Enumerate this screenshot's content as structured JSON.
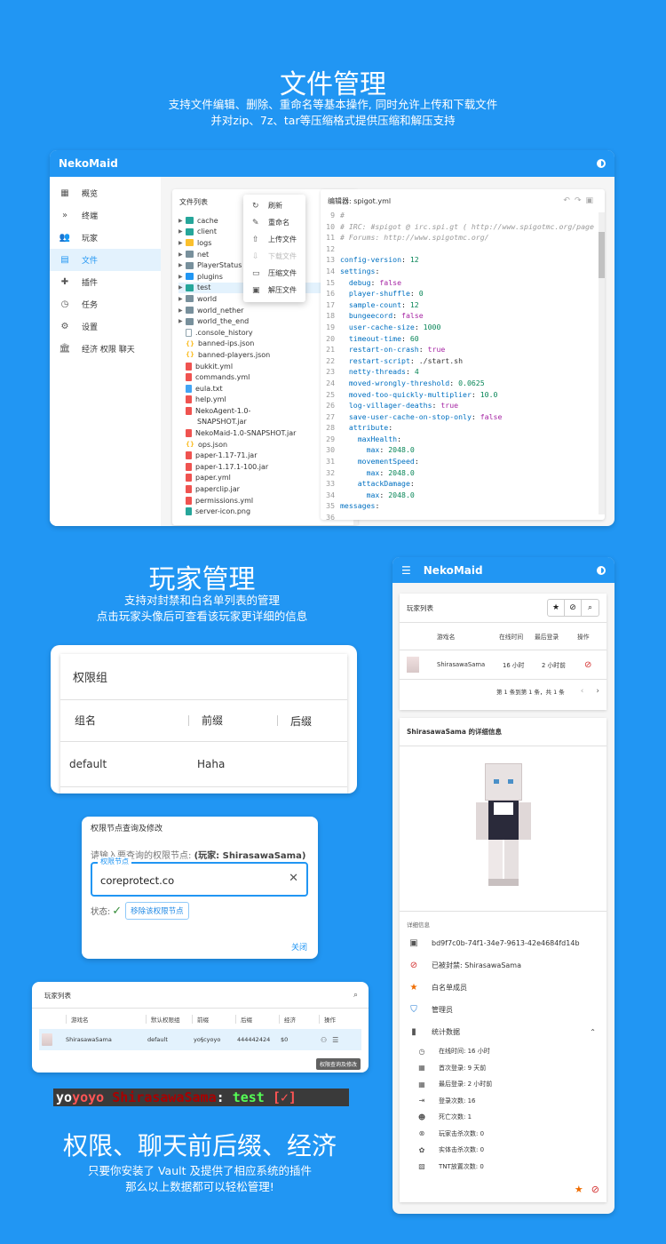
{
  "section1": {
    "title": "文件管理",
    "sub1": "支持文件编辑、删除、重命名等基本操作, 同时允许上传和下载文件",
    "sub2": "并对zip、7z、tar等压缩格式提供压缩和解压支持"
  },
  "app": {
    "brand": "NekoMaid",
    "nav": [
      {
        "label": "概览",
        "icon": "dashboard-icon"
      },
      {
        "label": "终端",
        "icon": "terminal-icon"
      },
      {
        "label": "玩家",
        "icon": "people-icon"
      },
      {
        "label": "文件",
        "icon": "file-icon"
      },
      {
        "label": "插件",
        "icon": "plugin-icon"
      },
      {
        "label": "任务",
        "icon": "clock-icon"
      },
      {
        "label": "设置",
        "icon": "gear-icon"
      },
      {
        "label": "经济 权限 聊天",
        "icon": "bank-icon"
      }
    ]
  },
  "files": {
    "header": "文件列表",
    "items": [
      {
        "name": "cache",
        "type": "folder-teal",
        "expand": true
      },
      {
        "name": "client",
        "type": "folder-teal",
        "expand": true
      },
      {
        "name": "logs",
        "type": "folder-yellow",
        "expand": true
      },
      {
        "name": "net",
        "type": "folder",
        "expand": true
      },
      {
        "name": "PlayerStatus",
        "type": "folder",
        "expand": true
      },
      {
        "name": "plugins",
        "type": "folder-blue",
        "expand": true
      },
      {
        "name": "test",
        "type": "folder-teal",
        "expand": true,
        "selected": true
      },
      {
        "name": "world",
        "type": "folder",
        "expand": true
      },
      {
        "name": "world_nether",
        "type": "folder",
        "expand": true
      },
      {
        "name": "world_the_end",
        "type": "folder",
        "expand": true
      },
      {
        "name": ".console_history",
        "type": "doc"
      },
      {
        "name": "banned-ips.json",
        "type": "json"
      },
      {
        "name": "banned-players.json",
        "type": "json"
      },
      {
        "name": "bukkit.yml",
        "type": "red"
      },
      {
        "name": "commands.yml",
        "type": "red"
      },
      {
        "name": "eula.txt",
        "type": "blue"
      },
      {
        "name": "help.yml",
        "type": "red"
      },
      {
        "name": "NekoAgent-1.0-",
        "type": "red"
      },
      {
        "name": "SNAPSHOT.jar",
        "type": "none"
      },
      {
        "name": "NekoMaid-1.0-SNAPSHOT.jar",
        "type": "red"
      },
      {
        "name": "ops.json",
        "type": "json"
      },
      {
        "name": "paper-1.17-71.jar",
        "type": "red"
      },
      {
        "name": "paper-1.17.1-100.jar",
        "type": "red"
      },
      {
        "name": "paper.yml",
        "type": "red"
      },
      {
        "name": "paperclip.jar",
        "type": "red"
      },
      {
        "name": "permissions.yml",
        "type": "red"
      },
      {
        "name": "server-icon.png",
        "type": "img"
      }
    ]
  },
  "context_menu": [
    {
      "label": "刷新",
      "icon": "refresh-icon"
    },
    {
      "label": "重命名",
      "icon": "edit-icon"
    },
    {
      "label": "上传文件",
      "icon": "upload-icon"
    },
    {
      "label": "下载文件",
      "icon": "download-icon",
      "disabled": true
    },
    {
      "label": "压缩文件",
      "icon": "archive-icon"
    },
    {
      "label": "解压文件",
      "icon": "unarchive-icon"
    }
  ],
  "editor": {
    "title": "编辑器: spigot.yml",
    "lines": [
      {
        "n": "9",
        "t": "#",
        "c": "c"
      },
      {
        "n": "10",
        "t": "# IRC: #spigot @ irc.spi.gt ( http://www.spigotmc.org/page",
        "c": "c"
      },
      {
        "n": "11",
        "t": "# Forums: http://www.spigotmc.org/",
        "c": "c"
      },
      {
        "n": "12",
        "t": "",
        "c": "s"
      },
      {
        "n": "13",
        "k": "config-version",
        "v": "12",
        "vc": "n"
      },
      {
        "n": "14",
        "k": "settings",
        "v": "",
        "vc": "s"
      },
      {
        "n": "15",
        "k": "  debug",
        "v": "false",
        "vc": "b"
      },
      {
        "n": "16",
        "k": "  player-shuffle",
        "v": "0",
        "vc": "n"
      },
      {
        "n": "17",
        "k": "  sample-count",
        "v": "12",
        "vc": "n"
      },
      {
        "n": "18",
        "k": "  bungeecord",
        "v": "false",
        "vc": "b"
      },
      {
        "n": "19",
        "k": "  user-cache-size",
        "v": "1000",
        "vc": "n"
      },
      {
        "n": "20",
        "k": "  timeout-time",
        "v": "60",
        "vc": "n"
      },
      {
        "n": "21",
        "k": "  restart-on-crash",
        "v": "true",
        "vc": "b"
      },
      {
        "n": "22",
        "k": "  restart-script",
        "v": "./start.sh",
        "vc": "s"
      },
      {
        "n": "23",
        "k": "  netty-threads",
        "v": "4",
        "vc": "n"
      },
      {
        "n": "24",
        "k": "  moved-wrongly-threshold",
        "v": "0.0625",
        "vc": "n"
      },
      {
        "n": "25",
        "k": "  moved-too-quickly-multiplier",
        "v": "10.0",
        "vc": "n"
      },
      {
        "n": "26",
        "k": "  log-villager-deaths",
        "v": "true",
        "vc": "b"
      },
      {
        "n": "27",
        "k": "  save-user-cache-on-stop-only",
        "v": "false",
        "vc": "b"
      },
      {
        "n": "28",
        "k": "  attribute",
        "v": "",
        "vc": "s"
      },
      {
        "n": "29",
        "k": "    maxHealth",
        "v": "",
        "vc": "s"
      },
      {
        "n": "30",
        "k": "      max",
        "v": "2048.0",
        "vc": "n"
      },
      {
        "n": "31",
        "k": "    movementSpeed",
        "v": "",
        "vc": "s"
      },
      {
        "n": "32",
        "k": "      max",
        "v": "2048.0",
        "vc": "n"
      },
      {
        "n": "33",
        "k": "    attackDamage",
        "v": "",
        "vc": "s"
      },
      {
        "n": "34",
        "k": "      max",
        "v": "2048.0",
        "vc": "n"
      },
      {
        "n": "35",
        "k": "messages",
        "v": "",
        "vc": "s"
      },
      {
        "n": "36",
        "t": "",
        "c": "s"
      }
    ]
  },
  "section2": {
    "title": "玩家管理",
    "sub1": "支持对封禁和白名单列表的管理",
    "sub2": "点击玩家头像后可查看该玩家更详细的信息"
  },
  "perm_group": {
    "title": "权限组",
    "col_name": "组名",
    "col_prefix": "前缀",
    "col_suffix": "后缀",
    "row_name": "default",
    "row_prefix": "Haha"
  },
  "perm_dialog": {
    "title": "权限节点查询及修改",
    "hint_prefix": "请输入要查询的权限节点: ",
    "hint_player": "(玩家: ShirasawaSama)",
    "field_label": "权限节点",
    "field_value": "coreprotect.co",
    "status_label": "状态:",
    "remove_btn": "移除该权限节点",
    "close_btn": "关闭"
  },
  "mini_players": {
    "title": "玩家列表",
    "headers": [
      "游戏名",
      "默认权限组",
      "前缀",
      "后缀",
      "经济",
      "操作"
    ],
    "row": {
      "name": "ShirasawaSama",
      "group": "default",
      "prefix": "yo§cyoyo",
      "suffix": "444442424",
      "money": "$0"
    },
    "tooltip": "权限查询及修改"
  },
  "chat_demo": {
    "p1": "yo",
    "p2": "yoyo",
    "p3": " ShirasawaSama",
    "p4": ": ",
    "p5": "test",
    "p6": " [✓]"
  },
  "section3": {
    "title": "权限、聊天前后缀、经济",
    "sub1": "只要你安装了 Vault 及提供了相应系统的插件",
    "sub2": "那么以上数据都可以轻松管理!"
  },
  "mobile": {
    "brand": "NekoMaid",
    "list_title": "玩家列表",
    "headers": [
      "游戏名",
      "在线时间",
      "最后登录",
      "操作"
    ],
    "row": {
      "name": "ShirasawaSama",
      "online": "16 小时",
      "last": "2 小时前"
    },
    "pager": "第 1 条到第 1 条，共 1 条",
    "detail_title": "ShirasawaSama 的详细信息",
    "info_header": "详细信息",
    "info": [
      {
        "label": "bd9f7c0b-74f1-34e7-9613-42e4684fd14b",
        "icon": "id-card-icon",
        "color": "#555"
      },
      {
        "label": "已被封禁: ShirasawaSama",
        "icon": "block-icon",
        "color": "#d32f2f"
      },
      {
        "label": "白名单成员",
        "icon": "star-icon",
        "color": "#ef6c00"
      },
      {
        "label": "管理员",
        "icon": "shield-icon",
        "color": "#1976d2"
      },
      {
        "label": "统计数据",
        "icon": "bar-chart-icon",
        "color": "#555"
      }
    ],
    "stats": [
      {
        "label": "在线时间: 16 小时",
        "icon": "clock-icon"
      },
      {
        "label": "首次登录: 9 天前",
        "icon": "calendar-icon"
      },
      {
        "label": "最后登录: 2 小时前",
        "icon": "calendar-icon"
      },
      {
        "label": "登录次数: 16",
        "icon": "login-icon"
      },
      {
        "label": "死亡次数: 1",
        "icon": "skull-icon"
      },
      {
        "label": "玩家击杀次数: 0",
        "icon": "no-kill-icon"
      },
      {
        "label": "实体击杀次数: 0",
        "icon": "paw-icon"
      },
      {
        "label": "TNT放置次数: 0",
        "icon": "tnt-icon"
      }
    ]
  },
  "colors": {
    "accent": "#2196f3",
    "danger": "#d32f2f",
    "orange": "#ef6c00"
  }
}
